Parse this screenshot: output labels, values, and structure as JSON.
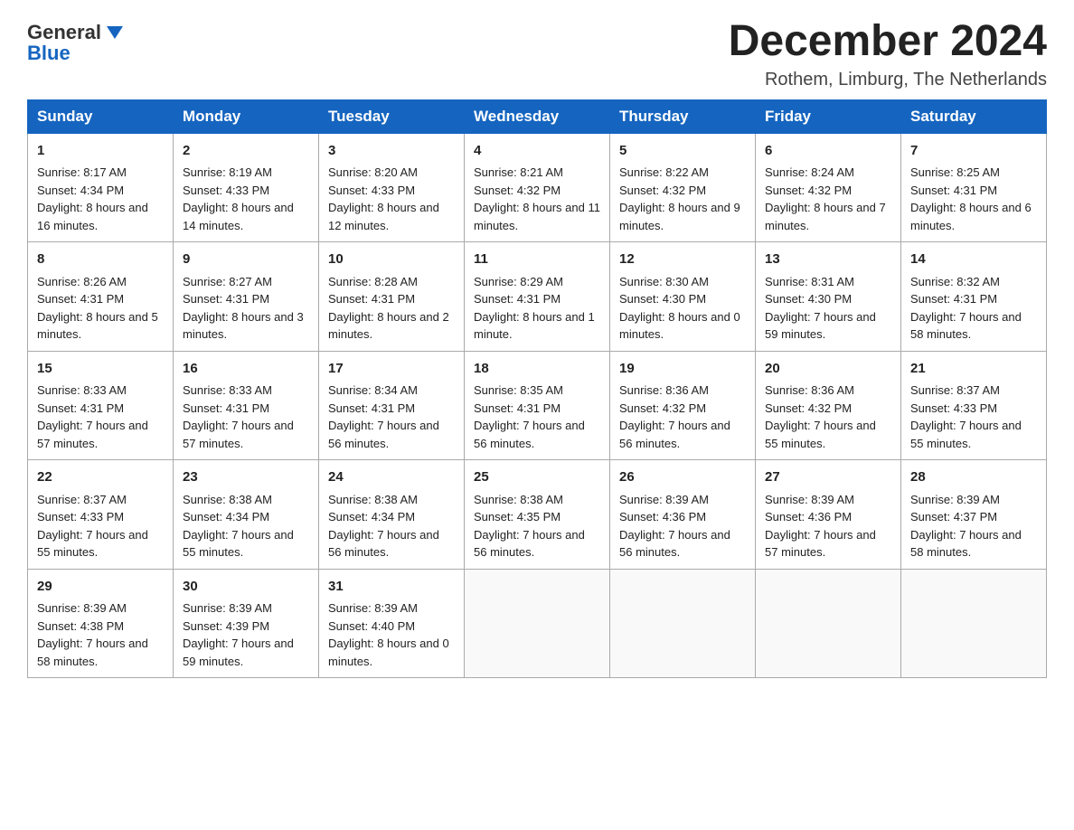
{
  "logo": {
    "general": "General",
    "blue": "Blue"
  },
  "header": {
    "month_year": "December 2024",
    "location": "Rothem, Limburg, The Netherlands"
  },
  "days_of_week": [
    "Sunday",
    "Monday",
    "Tuesday",
    "Wednesday",
    "Thursday",
    "Friday",
    "Saturday"
  ],
  "weeks": [
    [
      {
        "day": "1",
        "sunrise": "8:17 AM",
        "sunset": "4:34 PM",
        "daylight": "8 hours and 16 minutes."
      },
      {
        "day": "2",
        "sunrise": "8:19 AM",
        "sunset": "4:33 PM",
        "daylight": "8 hours and 14 minutes."
      },
      {
        "day": "3",
        "sunrise": "8:20 AM",
        "sunset": "4:33 PM",
        "daylight": "8 hours and 12 minutes."
      },
      {
        "day": "4",
        "sunrise": "8:21 AM",
        "sunset": "4:32 PM",
        "daylight": "8 hours and 11 minutes."
      },
      {
        "day": "5",
        "sunrise": "8:22 AM",
        "sunset": "4:32 PM",
        "daylight": "8 hours and 9 minutes."
      },
      {
        "day": "6",
        "sunrise": "8:24 AM",
        "sunset": "4:32 PM",
        "daylight": "8 hours and 7 minutes."
      },
      {
        "day": "7",
        "sunrise": "8:25 AM",
        "sunset": "4:31 PM",
        "daylight": "8 hours and 6 minutes."
      }
    ],
    [
      {
        "day": "8",
        "sunrise": "8:26 AM",
        "sunset": "4:31 PM",
        "daylight": "8 hours and 5 minutes."
      },
      {
        "day": "9",
        "sunrise": "8:27 AM",
        "sunset": "4:31 PM",
        "daylight": "8 hours and 3 minutes."
      },
      {
        "day": "10",
        "sunrise": "8:28 AM",
        "sunset": "4:31 PM",
        "daylight": "8 hours and 2 minutes."
      },
      {
        "day": "11",
        "sunrise": "8:29 AM",
        "sunset": "4:31 PM",
        "daylight": "8 hours and 1 minute."
      },
      {
        "day": "12",
        "sunrise": "8:30 AM",
        "sunset": "4:30 PM",
        "daylight": "8 hours and 0 minutes."
      },
      {
        "day": "13",
        "sunrise": "8:31 AM",
        "sunset": "4:30 PM",
        "daylight": "7 hours and 59 minutes."
      },
      {
        "day": "14",
        "sunrise": "8:32 AM",
        "sunset": "4:31 PM",
        "daylight": "7 hours and 58 minutes."
      }
    ],
    [
      {
        "day": "15",
        "sunrise": "8:33 AM",
        "sunset": "4:31 PM",
        "daylight": "7 hours and 57 minutes."
      },
      {
        "day": "16",
        "sunrise": "8:33 AM",
        "sunset": "4:31 PM",
        "daylight": "7 hours and 57 minutes."
      },
      {
        "day": "17",
        "sunrise": "8:34 AM",
        "sunset": "4:31 PM",
        "daylight": "7 hours and 56 minutes."
      },
      {
        "day": "18",
        "sunrise": "8:35 AM",
        "sunset": "4:31 PM",
        "daylight": "7 hours and 56 minutes."
      },
      {
        "day": "19",
        "sunrise": "8:36 AM",
        "sunset": "4:32 PM",
        "daylight": "7 hours and 56 minutes."
      },
      {
        "day": "20",
        "sunrise": "8:36 AM",
        "sunset": "4:32 PM",
        "daylight": "7 hours and 55 minutes."
      },
      {
        "day": "21",
        "sunrise": "8:37 AM",
        "sunset": "4:33 PM",
        "daylight": "7 hours and 55 minutes."
      }
    ],
    [
      {
        "day": "22",
        "sunrise": "8:37 AM",
        "sunset": "4:33 PM",
        "daylight": "7 hours and 55 minutes."
      },
      {
        "day": "23",
        "sunrise": "8:38 AM",
        "sunset": "4:34 PM",
        "daylight": "7 hours and 55 minutes."
      },
      {
        "day": "24",
        "sunrise": "8:38 AM",
        "sunset": "4:34 PM",
        "daylight": "7 hours and 56 minutes."
      },
      {
        "day": "25",
        "sunrise": "8:38 AM",
        "sunset": "4:35 PM",
        "daylight": "7 hours and 56 minutes."
      },
      {
        "day": "26",
        "sunrise": "8:39 AM",
        "sunset": "4:36 PM",
        "daylight": "7 hours and 56 minutes."
      },
      {
        "day": "27",
        "sunrise": "8:39 AM",
        "sunset": "4:36 PM",
        "daylight": "7 hours and 57 minutes."
      },
      {
        "day": "28",
        "sunrise": "8:39 AM",
        "sunset": "4:37 PM",
        "daylight": "7 hours and 58 minutes."
      }
    ],
    [
      {
        "day": "29",
        "sunrise": "8:39 AM",
        "sunset": "4:38 PM",
        "daylight": "7 hours and 58 minutes."
      },
      {
        "day": "30",
        "sunrise": "8:39 AM",
        "sunset": "4:39 PM",
        "daylight": "7 hours and 59 minutes."
      },
      {
        "day": "31",
        "sunrise": "8:39 AM",
        "sunset": "4:40 PM",
        "daylight": "8 hours and 0 minutes."
      },
      null,
      null,
      null,
      null
    ]
  ],
  "labels": {
    "sunrise": "Sunrise:",
    "sunset": "Sunset:",
    "daylight": "Daylight:"
  }
}
